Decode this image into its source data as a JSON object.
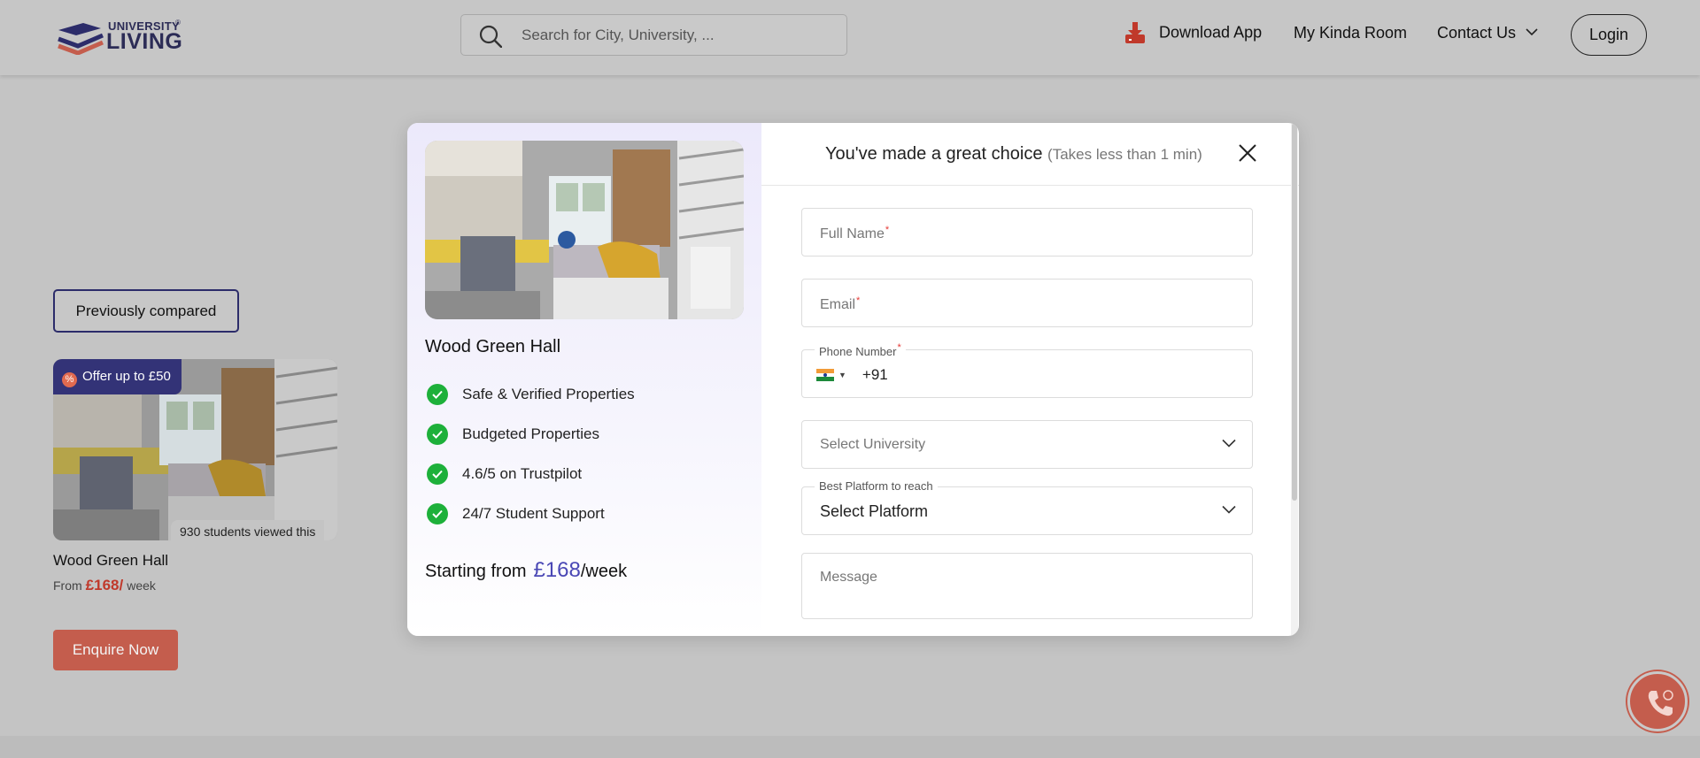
{
  "header": {
    "logo_small": "UNIVERSITY",
    "logo_main": "LIVING",
    "logo_reg": "®",
    "search_placeholder": "Search for City, University, ...",
    "nav": {
      "download": "Download App",
      "room": "My Kinda Room",
      "contact": "Contact Us"
    },
    "login": "Login"
  },
  "page": {
    "previously_compared": "Previously compared",
    "card": {
      "offer": "Offer up to £50",
      "offer_icon": "%",
      "viewed": "930 students viewed this",
      "title": "Wood Green Hall",
      "price_prefix": "From",
      "price": "£168/",
      "price_suffix": "week"
    },
    "enquire": "Enquire Now"
  },
  "modal": {
    "title": "Wood Green Hall",
    "features": [
      "Safe & Verified Properties",
      "Budgeted Properties",
      "4.6/5 on Trustpilot",
      "24/7 Student Support"
    ],
    "starting_label": "Starting from",
    "starting_price": "£168",
    "starting_unit": "/week",
    "heading": "You've made a great choice",
    "heading_sub": "(Takes less than 1 min)",
    "form": {
      "full_name": "Full Name",
      "email": "Email",
      "phone_label": "Phone Number",
      "dial_code": "+91",
      "university": "Select University",
      "platform_label": "Best Platform to reach",
      "platform": "Select Platform",
      "message": "Message",
      "required": "*"
    }
  },
  "colors": {
    "brand_navy": "#2c2c56",
    "accent_red": "#c45d4d",
    "price_purple": "#4a48b5",
    "check_green": "#1db03a",
    "overlay_grey": "#c4c4c4"
  },
  "icons": [
    "search-icon",
    "download-icon",
    "chevron-down-icon",
    "close-icon",
    "check-icon",
    "phone-icon",
    "flag-icon"
  ]
}
